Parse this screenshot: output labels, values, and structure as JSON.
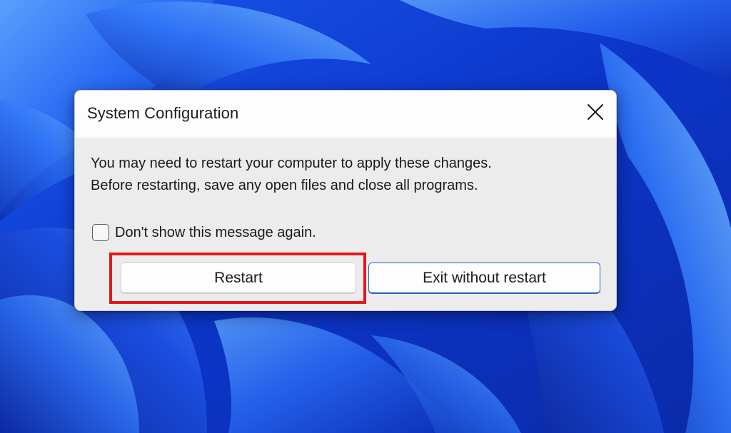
{
  "dialog": {
    "title": "System Configuration",
    "close_icon": "close-icon",
    "message_line1": "You may need to restart your computer to apply these changes.",
    "message_line2": "Before restarting, save any open files and close all programs.",
    "checkbox_label": "Don't show this message again.",
    "checkbox_checked": false,
    "restart_label": "Restart",
    "exit_label": "Exit without restart"
  },
  "colors": {
    "wallpaper_blue": "#0b2fbf",
    "highlight_red": "#e3181b",
    "default_button_border": "#1f67c6"
  }
}
